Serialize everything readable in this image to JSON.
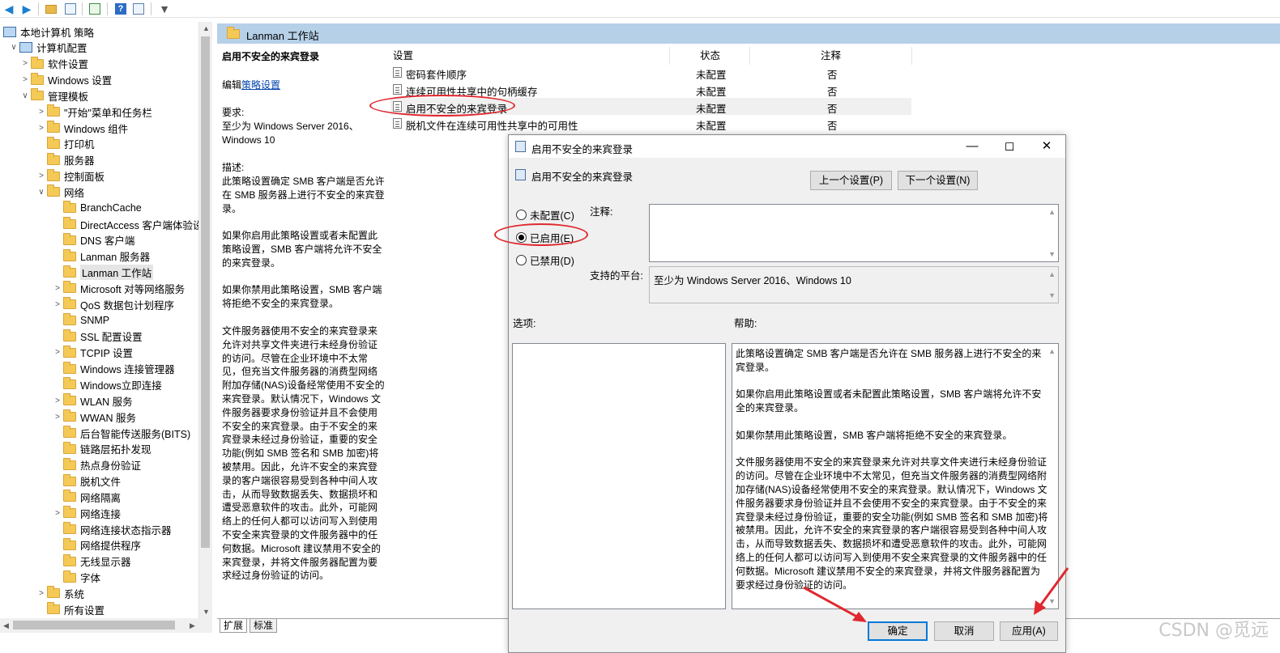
{
  "toolbar": {
    "icons": [
      "back-arrow-icon",
      "forward-arrow-icon",
      "up-folder-icon",
      "show-tree-icon",
      "export-icon",
      "help-icon",
      "view-icon",
      "filter-icon"
    ]
  },
  "tree": {
    "items": [
      {
        "label": "本地计算机 策略",
        "level": 0,
        "expand": "",
        "icon": "pc"
      },
      {
        "label": "计算机配置",
        "level": 1,
        "expand": "v",
        "icon": "pc"
      },
      {
        "label": "软件设置",
        "level": 2,
        "expand": ">",
        "icon": "folder"
      },
      {
        "label": "Windows 设置",
        "level": 2,
        "expand": ">",
        "icon": "folder"
      },
      {
        "label": "管理模板",
        "level": 2,
        "expand": "v",
        "icon": "folder"
      },
      {
        "label": "\"开始\"菜单和任务栏",
        "level": 3,
        "expand": ">",
        "icon": "folder"
      },
      {
        "label": "Windows 组件",
        "level": 3,
        "expand": ">",
        "icon": "folder"
      },
      {
        "label": "打印机",
        "level": 3,
        "expand": "",
        "icon": "folder"
      },
      {
        "label": "服务器",
        "level": 3,
        "expand": "",
        "icon": "folder"
      },
      {
        "label": "控制面板",
        "level": 3,
        "expand": ">",
        "icon": "folder"
      },
      {
        "label": "网络",
        "level": 3,
        "expand": "v",
        "icon": "folder"
      },
      {
        "label": "BranchCache",
        "level": 4,
        "expand": "",
        "icon": "folder"
      },
      {
        "label": "DirectAccess 客户端体验设",
        "level": 4,
        "expand": "",
        "icon": "folder"
      },
      {
        "label": "DNS 客户端",
        "level": 4,
        "expand": "",
        "icon": "folder"
      },
      {
        "label": "Lanman 服务器",
        "level": 4,
        "expand": "",
        "icon": "folder"
      },
      {
        "label": "Lanman 工作站",
        "level": 4,
        "expand": "",
        "icon": "folder",
        "selected": true
      },
      {
        "label": "Microsoft 对等网络服务",
        "level": 4,
        "expand": ">",
        "icon": "folder"
      },
      {
        "label": "QoS 数据包计划程序",
        "level": 4,
        "expand": ">",
        "icon": "folder"
      },
      {
        "label": "SNMP",
        "level": 4,
        "expand": "",
        "icon": "folder"
      },
      {
        "label": "SSL 配置设置",
        "level": 4,
        "expand": "",
        "icon": "folder"
      },
      {
        "label": "TCPIP 设置",
        "level": 4,
        "expand": ">",
        "icon": "folder"
      },
      {
        "label": "Windows 连接管理器",
        "level": 4,
        "expand": "",
        "icon": "folder"
      },
      {
        "label": "Windows立即连接",
        "level": 4,
        "expand": "",
        "icon": "folder"
      },
      {
        "label": "WLAN 服务",
        "level": 4,
        "expand": ">",
        "icon": "folder"
      },
      {
        "label": "WWAN 服务",
        "level": 4,
        "expand": ">",
        "icon": "folder"
      },
      {
        "label": "后台智能传送服务(BITS)",
        "level": 4,
        "expand": "",
        "icon": "folder"
      },
      {
        "label": "链路层拓扑发现",
        "level": 4,
        "expand": "",
        "icon": "folder"
      },
      {
        "label": "热点身份验证",
        "level": 4,
        "expand": "",
        "icon": "folder"
      },
      {
        "label": "脱机文件",
        "level": 4,
        "expand": "",
        "icon": "folder"
      },
      {
        "label": "网络隔离",
        "level": 4,
        "expand": "",
        "icon": "folder"
      },
      {
        "label": "网络连接",
        "level": 4,
        "expand": ">",
        "icon": "folder"
      },
      {
        "label": "网络连接状态指示器",
        "level": 4,
        "expand": "",
        "icon": "folder"
      },
      {
        "label": "网络提供程序",
        "level": 4,
        "expand": "",
        "icon": "folder"
      },
      {
        "label": "无线显示器",
        "level": 4,
        "expand": "",
        "icon": "folder"
      },
      {
        "label": "字体",
        "level": 4,
        "expand": "",
        "icon": "folder"
      },
      {
        "label": "系统",
        "level": 3,
        "expand": ">",
        "icon": "folder"
      },
      {
        "label": "所有设置",
        "level": 3,
        "expand": "",
        "icon": "folder"
      }
    ]
  },
  "rpane": {
    "title": "Lanman 工作站",
    "desc": {
      "heading": "启用不安全的来宾登录",
      "edit_prefix": "编辑",
      "edit_link": "策略设置",
      "req_label": "要求:",
      "req_text": "至少为 Windows Server 2016、Windows 10",
      "desc_label": "描述:",
      "p1": "此策略设置确定 SMB 客户端是否允许在 SMB 服务器上进行不安全的来宾登录。",
      "p2": "如果你启用此策略设置或者未配置此策略设置，SMB 客户端将允许不安全的来宾登录。",
      "p3": "如果你禁用此策略设置，SMB 客户端将拒绝不安全的来宾登录。",
      "p4": "文件服务器使用不安全的来宾登录来允许对共享文件夹进行未经身份验证的访问。尽管在企业环境中不太常见，但充当文件服务器的消费型网络附加存储(NAS)设备经常使用不安全的来宾登录。默认情况下，Windows 文件服务器要求身份验证并且不会使用不安全的来宾登录。由于不安全的来宾登录未经过身份验证，重要的安全功能(例如 SMB 签名和 SMB 加密)将被禁用。因此，允许不安全的来宾登录的客户端很容易受到各种中间人攻击，从而导致数据丢失、数据损坏和遭受恶意软件的攻击。此外，可能网络上的任何人都可以访问写入到使用不安全来宾登录的文件服务器中的任何数据。Microsoft 建议禁用不安全的来宾登录，并将文件服务器配置为要求经过身份验证的访问。"
    },
    "columns": {
      "setting": "设置",
      "state": "状态",
      "comment": "注释"
    },
    "rows": [
      {
        "name": "密码套件顺序",
        "state": "未配置",
        "comment": "否"
      },
      {
        "name": "连续可用性共享中的句柄缓存",
        "state": "未配置",
        "comment": "否"
      },
      {
        "name": "启用不安全的来宾登录",
        "state": "未配置",
        "comment": "否"
      },
      {
        "name": "脱机文件在连续可用性共享中的可用性",
        "state": "未配置",
        "comment": "否"
      }
    ],
    "tabs": [
      "扩展",
      "标准"
    ]
  },
  "dialog": {
    "title": "启用不安全的来宾登录",
    "heading": "启用不安全的来宾登录",
    "prev_btn": "上一个设置(P)",
    "next_btn": "下一个设置(N)",
    "radio_not_configured": "未配置(C)",
    "radio_enabled": "已启用(E)",
    "radio_disabled": "已禁用(D)",
    "selected_radio": "enabled",
    "comment_label": "注释:",
    "platform_label": "支持的平台:",
    "platform_value": "至少为 Windows Server 2016、Windows 10",
    "options_label": "选项:",
    "help_label": "帮助:",
    "help_p1": "此策略设置确定 SMB 客户端是否允许在 SMB 服务器上进行不安全的来宾登录。",
    "help_p2": "如果你启用此策略设置或者未配置此策略设置，SMB 客户端将允许不安全的来宾登录。",
    "help_p3": "如果你禁用此策略设置，SMB 客户端将拒绝不安全的来宾登录。",
    "help_p4": "文件服务器使用不安全的来宾登录来允许对共享文件夹进行未经身份验证的访问。尽管在企业环境中不太常见，但充当文件服务器的消费型网络附加存储(NAS)设备经常使用不安全的来宾登录。默认情况下，Windows 文件服务器要求身份验证并且不会使用不安全的来宾登录。由于不安全的来宾登录未经过身份验证，重要的安全功能(例如 SMB 签名和 SMB 加密)将被禁用。因此，允许不安全的来宾登录的客户端很容易受到各种中间人攻击，从而导致数据丢失、数据损坏和遭受恶意软件的攻击。此外，可能网络上的任何人都可以访问写入到使用不安全来宾登录的文件服务器中的任何数据。Microsoft 建议禁用不安全的来宾登录，并将文件服务器配置为要求经过身份验证的访问。",
    "ok_btn": "确定",
    "cancel_btn": "取消",
    "apply_btn": "应用(A)"
  },
  "annotation_color": "#e0282e",
  "watermark": "CSDN @觅远"
}
